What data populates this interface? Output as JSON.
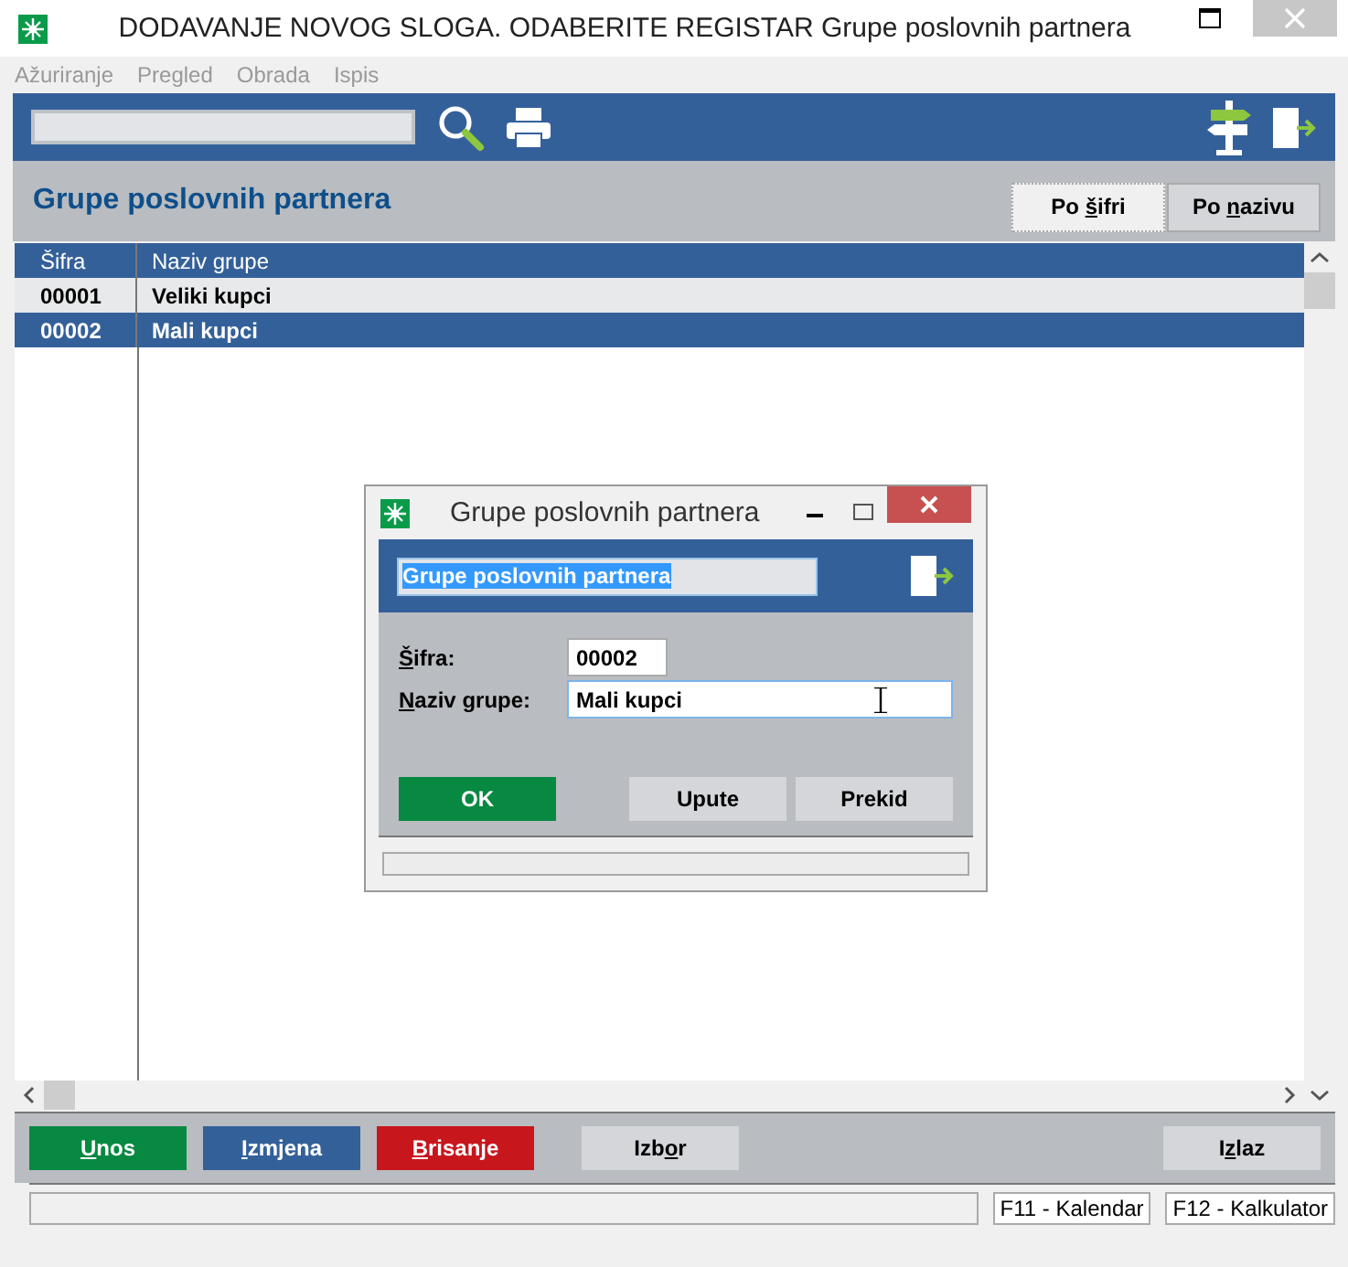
{
  "window": {
    "title": "DODAVANJE NOVOG SLOGA. ODABERITE REGISTAR Grupe poslovnih partnera"
  },
  "menu": [
    "Ažuriranje",
    "Pregled",
    "Obrada",
    "Ispis"
  ],
  "header": {
    "title": "Grupe poslovnih partnera",
    "sort_tabs": [
      {
        "label": [
          {
            "text": "Po "
          },
          {
            "text": "š",
            "underlined": true
          },
          {
            "text": "ifri"
          }
        ],
        "selected": true
      },
      {
        "label": [
          {
            "text": "Po "
          },
          {
            "text": "n",
            "underlined": true
          },
          {
            "text": "azivu"
          }
        ],
        "selected": false
      }
    ]
  },
  "table": {
    "columns": [
      "Šifra",
      "Naziv grupe"
    ],
    "rows": [
      {
        "cells": [
          "00001",
          "Veliki kupci"
        ],
        "selected": false
      },
      {
        "cells": [
          "00002",
          "Mali kupci"
        ],
        "selected": true
      }
    ]
  },
  "dialog": {
    "title": "Grupe poslovnih partnera",
    "register": {
      "value": "Grupe poslovnih partnera",
      "text_selected": true
    },
    "fields": [
      {
        "label": [
          {
            "text": "Š",
            "underlined": true
          },
          {
            "text": "ifra:"
          }
        ],
        "value": "00002",
        "kind": "short"
      },
      {
        "label": [
          {
            "text": "N",
            "underlined": true
          },
          {
            "text": "aziv grupe:"
          }
        ],
        "value": "Mali kupci",
        "kind": "long"
      }
    ],
    "buttons": [
      {
        "label": "OK",
        "kind": "green"
      },
      {
        "label": "Upute",
        "kind": "plain"
      },
      {
        "label": "Prekid",
        "kind": "plain"
      }
    ]
  },
  "actions": [
    {
      "label": [
        {
          "text": "U",
          "underlined": true
        },
        {
          "text": "nos"
        }
      ],
      "kind": "green"
    },
    {
      "label": [
        {
          "text": "I",
          "underlined": true
        },
        {
          "text": "zmjena"
        }
      ],
      "kind": "blue"
    },
    {
      "label": [
        {
          "text": "B",
          "underlined": true
        },
        {
          "text": "risanje"
        }
      ],
      "kind": "red"
    },
    {
      "label": [
        {
          "text": "Izb"
        },
        {
          "text": "o",
          "underlined": true
        },
        {
          "text": "r"
        }
      ],
      "kind": "plain"
    },
    {
      "label": [
        {
          "text": "I"
        },
        {
          "text": "z",
          "underlined": true
        },
        {
          "text": "laz"
        }
      ],
      "kind": "plain"
    }
  ],
  "status_bar": [
    "F11 - Kalendar",
    "F12 - Kalkulator"
  ]
}
